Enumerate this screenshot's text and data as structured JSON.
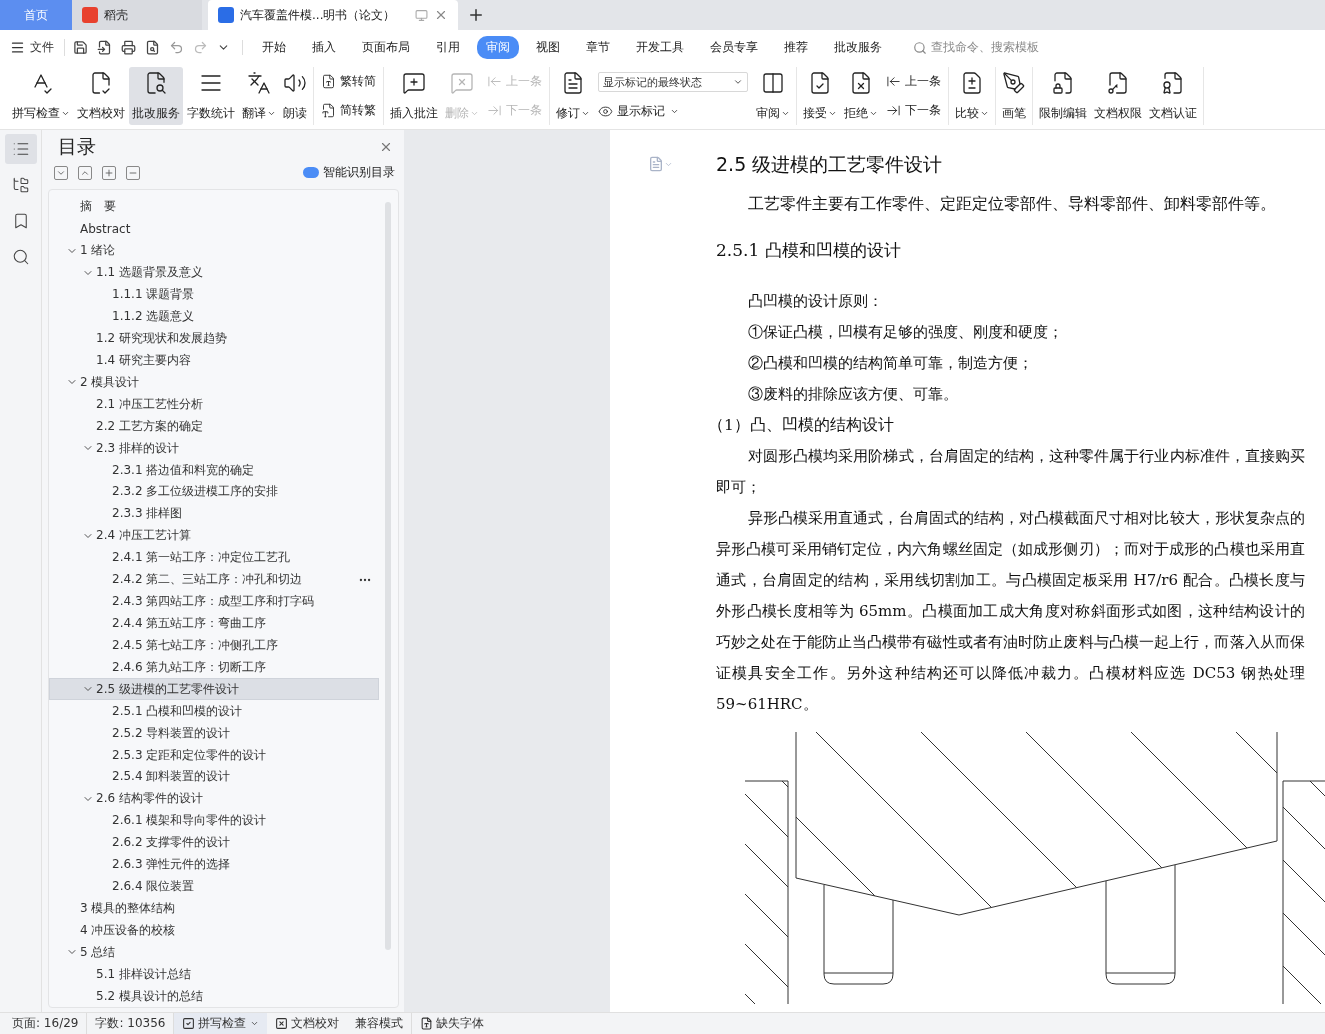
{
  "tabs": [
    {
      "label": "首页",
      "kind": "home",
      "selected": false
    },
    {
      "label": "稻壳",
      "kind": "app",
      "selected": false
    },
    {
      "label": "汽车覆盖件模...明书（论文）",
      "kind": "doc",
      "selected": true
    }
  ],
  "menu": {
    "file": "文件",
    "items": [
      {
        "label": "开始",
        "selected": false
      },
      {
        "label": "插入",
        "selected": false
      },
      {
        "label": "页面布局",
        "selected": false
      },
      {
        "label": "引用",
        "selected": false
      },
      {
        "label": "审阅",
        "selected": true
      },
      {
        "label": "视图",
        "selected": false
      },
      {
        "label": "章节",
        "selected": false
      },
      {
        "label": "开发工具",
        "selected": false
      },
      {
        "label": "会员专享",
        "selected": false
      },
      {
        "label": "推荐",
        "selected": false
      },
      {
        "label": "批改服务",
        "selected": false
      }
    ],
    "search_placeholder": "查找命令、搜索模板"
  },
  "ribbon": [
    [
      {
        "kind": "big",
        "label": "拼写检查",
        "caret": true,
        "disabled": false,
        "selected": false
      },
      {
        "kind": "big",
        "label": "文档校对",
        "caret": false,
        "disabled": false,
        "selected": false
      },
      {
        "kind": "big",
        "label": "批改服务",
        "caret": false,
        "disabled": false,
        "selected": true
      },
      {
        "kind": "big",
        "label": "字数统计",
        "caret": false,
        "disabled": false,
        "selected": false
      },
      {
        "kind": "big",
        "label": "翻译",
        "caret": true,
        "disabled": false,
        "selected": false
      },
      {
        "kind": "big",
        "label": "朗读",
        "caret": false,
        "disabled": false,
        "selected": false
      }
    ],
    [
      {
        "kind": "stack",
        "items": [
          {
            "label": "繁转简",
            "caret": false,
            "disabled": false
          },
          {
            "label": "简转繁",
            "caret": false,
            "disabled": false
          }
        ]
      }
    ],
    [
      {
        "kind": "big",
        "label": "插入批注",
        "caret": false,
        "disabled": false,
        "selected": false
      },
      {
        "kind": "big",
        "label": "删除",
        "caret": true,
        "disabled": true,
        "selected": false
      },
      {
        "kind": "stack",
        "items": [
          {
            "label": "上一条",
            "caret": false,
            "disabled": true
          },
          {
            "label": "下一条",
            "caret": false,
            "disabled": true
          }
        ]
      }
    ],
    [
      {
        "kind": "big",
        "label": "修订",
        "caret": true,
        "disabled": false,
        "selected": false
      },
      {
        "kind": "select",
        "value": "显示标记的最终状态",
        "items": [
          {
            "label": "显示标记",
            "caret": true,
            "disabled": false
          }
        ]
      },
      {
        "kind": "big",
        "label": "审阅",
        "caret": true,
        "disabled": false,
        "selected": false
      }
    ],
    [
      {
        "kind": "big",
        "label": "接受",
        "caret": true,
        "disabled": false,
        "selected": false
      },
      {
        "kind": "big",
        "label": "拒绝",
        "caret": true,
        "disabled": false,
        "selected": false
      },
      {
        "kind": "stack",
        "items": [
          {
            "label": "上一条",
            "caret": false,
            "disabled": false
          },
          {
            "label": "下一条",
            "caret": false,
            "disabled": false
          }
        ]
      }
    ],
    [
      {
        "kind": "big",
        "label": "比较",
        "caret": true,
        "disabled": false,
        "selected": false
      }
    ],
    [
      {
        "kind": "big",
        "label": "画笔",
        "caret": false,
        "disabled": false,
        "selected": false
      }
    ],
    [
      {
        "kind": "big",
        "label": "限制编辑",
        "caret": false,
        "disabled": false,
        "selected": false
      },
      {
        "kind": "big",
        "label": "文档权限",
        "caret": false,
        "disabled": false,
        "selected": false
      },
      {
        "kind": "big",
        "label": "文档认证",
        "caret": false,
        "disabled": false,
        "selected": false
      }
    ]
  ],
  "nav_rail": [
    {
      "selected": true
    },
    {
      "selected": false
    },
    {
      "selected": false
    },
    {
      "selected": false
    }
  ],
  "toc": {
    "title": "目录",
    "smart_link": "智能识别目录",
    "items": [
      {
        "label": "摘　要",
        "selected": false
      },
      {
        "label": "Abstract",
        "selected": false
      },
      {
        "label": "1  绪论",
        "selected": false,
        "expanded": true,
        "children": [
          {
            "label": "1.1 选题背景及意义",
            "selected": false,
            "expanded": true,
            "children": [
              {
                "label": "1.1.1  课题背景",
                "selected": false
              },
              {
                "label": "1.1.2  选题意义",
                "selected": false
              }
            ]
          },
          {
            "label": "1.2  研究现状和发展趋势",
            "selected": false
          },
          {
            "label": "1.4  研究主要内容",
            "selected": false
          }
        ]
      },
      {
        "label": "2  模具设计",
        "selected": false,
        "expanded": true,
        "children": [
          {
            "label": "2.1  冲压工艺性分析",
            "selected": false
          },
          {
            "label": "2.2  工艺方案的确定",
            "selected": false
          },
          {
            "label": "2.3  排样的设计",
            "selected": false,
            "expanded": true,
            "children": [
              {
                "label": "2.3.1  搭边值和料宽的确定",
                "selected": false
              },
              {
                "label": "2.3.2  多工位级进模工序的安排",
                "selected": false
              },
              {
                "label": "2.3.3  排样图",
                "selected": false
              }
            ]
          },
          {
            "label": "2.4  冲压工艺计算",
            "selected": false,
            "expanded": true,
            "children": [
              {
                "label": "2.4.1 第一站工序：冲定位工艺孔",
                "selected": false
              },
              {
                "label": "2.4.2 第二、三站工序：冲孔和切边",
                "selected": false,
                "more": true
              },
              {
                "label": "2.4.3 第四站工序：成型工序和打字码",
                "selected": false
              },
              {
                "label": "2.4.4 第五站工序：弯曲工序",
                "selected": false
              },
              {
                "label": "2.4.5 第七站工序：冲侧孔工序",
                "selected": false
              },
              {
                "label": "2.4.6 第九站工序：切断工序",
                "selected": false
              }
            ]
          },
          {
            "label": "2.5  级进模的工艺零件设计",
            "selected": true,
            "expanded": true,
            "children": [
              {
                "label": "2.5.1  凸模和凹模的设计",
                "selected": false
              },
              {
                "label": "2.5.2  导料装置的设计",
                "selected": false
              },
              {
                "label": "2.5.3  定距和定位零件的设计",
                "selected": false
              },
              {
                "label": "2.5.4  卸料装置的设计",
                "selected": false
              }
            ]
          },
          {
            "label": "2.6  结构零件的设计",
            "selected": false,
            "expanded": true,
            "children": [
              {
                "label": "2.6.1  模架和导向零件的设计",
                "selected": false
              },
              {
                "label": "2.6.2  支撑零件的设计",
                "selected": false
              },
              {
                "label": "2.6.3  弹性元件的选择",
                "selected": false
              },
              {
                "label": "2.6.4  限位装置",
                "selected": false
              }
            ]
          }
        ]
      },
      {
        "label": "3  模具的整体结构",
        "selected": false
      },
      {
        "label": "4  冲压设备的校核",
        "selected": false
      },
      {
        "label": "5 总结",
        "selected": false,
        "expanded": true,
        "children": [
          {
            "label": "5.1  排样设计总结",
            "selected": false
          },
          {
            "label": "5.2  模具设计的总结",
            "selected": false
          }
        ]
      }
    ]
  },
  "document": [
    {
      "kind": "h2",
      "text": "2.5  级进模的工艺零件设计"
    },
    {
      "kind": "lead",
      "text": "工艺零件主要有工作零件、定距定位零部件、导料零部件、卸料零部件等。"
    },
    {
      "kind": "h3",
      "text": "2.5.1  凸模和凹模的设计"
    },
    {
      "kind": "p",
      "text": "凸凹模的设计原则："
    },
    {
      "kind": "p",
      "text": "①保证凸模，凹模有足够的强度、刚度和硬度；"
    },
    {
      "kind": "p",
      "text": "②凸模和凹模的结构简单可靠，制造方便；"
    },
    {
      "kind": "p",
      "text": "③废料的排除应该方便、可靠。"
    },
    {
      "kind": "sub",
      "text": "（1）凸、凹模的结构设计"
    },
    {
      "kind": "p",
      "text": "对圆形凸模均采用阶梯式，台肩固定的结构，这种零件属于行业内标准件，直接购买即可；"
    },
    {
      "kind": "p",
      "text": "异形凸模采用直通式，台肩固式的结构，对凸模截面尺寸相对比较大，形状复杂点的异形凸模可采用销钉定位，内六角螺丝固定（如成形侧刃）；而对于成形的凸模也采用直通式，台肩固定的结构，采用线切割加工。与凸模固定板采用 H7/r6 配合。凸模长度与外形凸模长度相等为 65mm。凸模面加工成大角度对称斜面形式如图，这种结构设计的巧妙之处在于能防止当凸模带有磁性或者有油时防止废料与凸模一起上行，而落入从而保证模具安全工作。另外这种结构还可以降低冲裁力。凸模材料应选 DC53 钢热处理 59~61HRC。"
    }
  ],
  "status_bar": [
    {
      "kind": "text",
      "label": "页面: 16/29"
    },
    {
      "kind": "text",
      "label": "字数: 10356"
    },
    {
      "kind": "check",
      "label": "拼写检查",
      "caret": true
    },
    {
      "kind": "proof",
      "label": "文档校对",
      "caret": false
    },
    {
      "kind": "text",
      "label": "兼容模式"
    },
    {
      "kind": "font",
      "label": "缺失字体",
      "caret": false
    }
  ]
}
